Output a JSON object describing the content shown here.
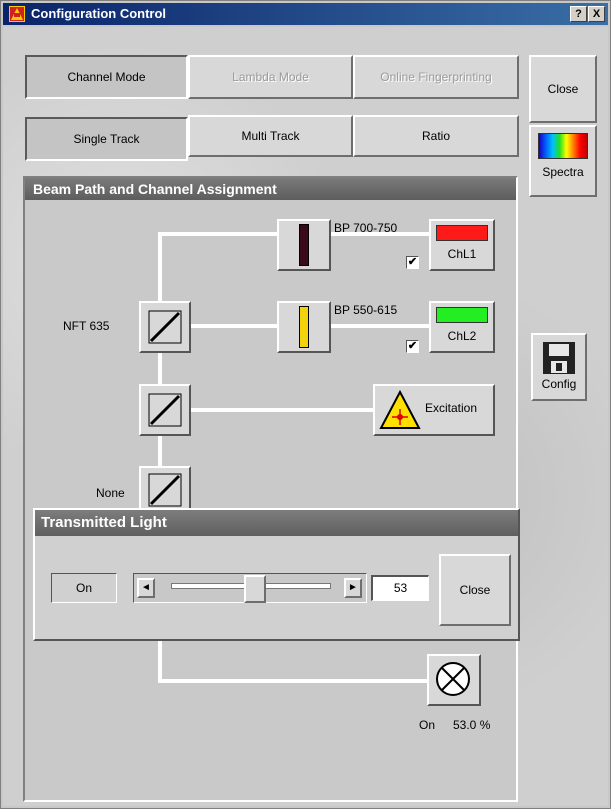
{
  "window": {
    "title": "Configuration Control",
    "help_label": "?",
    "close_label": "X"
  },
  "mode_tabs": [
    {
      "label": "Channel Mode",
      "state": "active"
    },
    {
      "label": "Lambda Mode",
      "state": "disabled"
    },
    {
      "label": "Online Fingerprinting",
      "state": "disabled"
    }
  ],
  "track_tabs": [
    {
      "label": "Single Track",
      "state": "active"
    },
    {
      "label": "Multi Track",
      "state": "normal"
    },
    {
      "label": "Ratio",
      "state": "normal"
    }
  ],
  "side": {
    "close_label": "Close",
    "spectra_label": "Spectra",
    "config_label": "Config"
  },
  "beam_panel": {
    "title": "Beam Path and Channel Assignment",
    "filter1_label": "BP 700-750",
    "filter2_label": "BP 550-615",
    "channel1_label": "ChL1",
    "channel2_label": "ChL2",
    "channel1_color": "#ff1a1a",
    "channel2_color": "#22ee22",
    "channel1_checked": true,
    "channel2_checked": true,
    "check_mark": "✔",
    "filter1_color": "#3a0a1a",
    "filter2_color": "#f2d20a",
    "dichroic1_label": "NFT 635",
    "dichroic3_label": "None",
    "excitation_label": "Excitation",
    "lamp_state": "On",
    "lamp_percent": "53.0 %"
  },
  "transmitted_light": {
    "title": "Transmitted Light",
    "state_label": "On",
    "slider_value": "53",
    "slider_max": 100,
    "close_label": "Close",
    "left_arrow": "◄",
    "right_arrow": "►"
  }
}
